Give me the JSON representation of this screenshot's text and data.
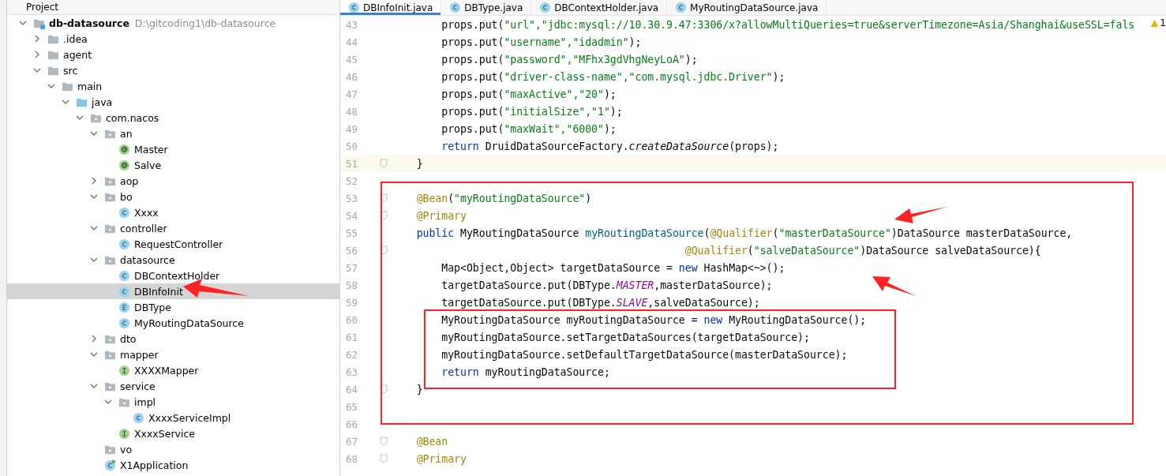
{
  "project_panel": {
    "title": "Project"
  },
  "tree": {
    "name": "db-datasource",
    "path": "D:\\gitcoding1\\db-datasource",
    "kind": "module",
    "expanded": true,
    "selected": false,
    "children": [
      {
        "name": ".idea",
        "kind": "folder",
        "expanded": false,
        "selected": false
      },
      {
        "name": "agent",
        "kind": "folder",
        "expanded": false,
        "selected": false
      },
      {
        "name": "src",
        "kind": "folder",
        "expanded": true,
        "selected": false,
        "children": [
          {
            "name": "main",
            "kind": "folder",
            "expanded": true,
            "selected": false,
            "children": [
              {
                "name": "java",
                "kind": "source",
                "expanded": true,
                "selected": false,
                "children": [
                  {
                    "name": "com.nacos",
                    "kind": "package",
                    "expanded": true,
                    "selected": false,
                    "children": [
                      {
                        "name": "an",
                        "kind": "package",
                        "expanded": true,
                        "selected": false,
                        "children": [
                          {
                            "name": "Master",
                            "kind": "annotation",
                            "selected": false
                          },
                          {
                            "name": "Salve",
                            "kind": "annotation",
                            "selected": false
                          }
                        ]
                      },
                      {
                        "name": "aop",
                        "kind": "package",
                        "expanded": false,
                        "selected": false
                      },
                      {
                        "name": "bo",
                        "kind": "package",
                        "expanded": true,
                        "selected": false,
                        "children": [
                          {
                            "name": "Xxxx",
                            "kind": "class",
                            "selected": false
                          }
                        ]
                      },
                      {
                        "name": "controller",
                        "kind": "package",
                        "expanded": true,
                        "selected": false,
                        "children": [
                          {
                            "name": "RequestController",
                            "kind": "class",
                            "selected": false
                          }
                        ]
                      },
                      {
                        "name": "datasource",
                        "kind": "package",
                        "expanded": true,
                        "selected": false,
                        "children": [
                          {
                            "name": "DBContextHolder",
                            "kind": "class",
                            "selected": false
                          },
                          {
                            "name": "DBInfoInit",
                            "kind": "class",
                            "selected": true
                          },
                          {
                            "name": "DBType",
                            "kind": "enum",
                            "selected": false
                          },
                          {
                            "name": "MyRoutingDataSource",
                            "kind": "class",
                            "selected": false
                          }
                        ]
                      },
                      {
                        "name": "dto",
                        "kind": "package",
                        "expanded": false,
                        "selected": false
                      },
                      {
                        "name": "mapper",
                        "kind": "package",
                        "expanded": true,
                        "selected": false,
                        "children": [
                          {
                            "name": "XXXXMapper",
                            "kind": "interface",
                            "selected": false
                          }
                        ]
                      },
                      {
                        "name": "service",
                        "kind": "package",
                        "expanded": true,
                        "selected": false,
                        "children": [
                          {
                            "name": "impl",
                            "kind": "package",
                            "expanded": true,
                            "selected": false,
                            "children": [
                              {
                                "name": "XxxxServiceImpl",
                                "kind": "class",
                                "selected": false
                              }
                            ]
                          },
                          {
                            "name": "XxxxService",
                            "kind": "interface",
                            "selected": false
                          }
                        ]
                      },
                      {
                        "name": "vo",
                        "kind": "package",
                        "selected": false
                      },
                      {
                        "name": "X1Application",
                        "kind": "app",
                        "selected": false
                      }
                    ]
                  }
                ]
              }
            ]
          }
        ]
      }
    ]
  },
  "tabs": [
    {
      "label": "DBInfoInit.java",
      "selected": true
    },
    {
      "label": "DBType.java",
      "selected": false
    },
    {
      "label": "DBContextHolder.java",
      "selected": false
    },
    {
      "label": "MyRoutingDataSource.java",
      "selected": false
    }
  ],
  "editor": {
    "warning_count": "1",
    "lines": [
      {
        "number": "43",
        "segments": [
          {
            "kind": "plain",
            "text": "        props.put("
          },
          {
            "kind": "string",
            "text": "\"url\",\"jdbc:mysql://10.30.9.47:3306/x?allowMultiQueries=true&serverTimezone=Asia/Shanghai&useSSL=fals"
          }
        ]
      },
      {
        "number": "44",
        "segments": [
          {
            "kind": "plain",
            "text": "        props.put("
          },
          {
            "kind": "string",
            "text": "\"username\",\"idadmin\""
          },
          {
            "kind": "plain",
            "text": ");"
          }
        ]
      },
      {
        "number": "45",
        "segments": [
          {
            "kind": "plain",
            "text": "        props.put("
          },
          {
            "kind": "string",
            "text": "\"password\",\"MFhx3gdVhgNeyLoA\""
          },
          {
            "kind": "plain",
            "text": ");"
          }
        ]
      },
      {
        "number": "46",
        "segments": [
          {
            "kind": "plain",
            "text": "        props.put("
          },
          {
            "kind": "string",
            "text": "\"driver-class-name\",\"com.mysql.jdbc.Driver\""
          },
          {
            "kind": "plain",
            "text": ");"
          }
        ]
      },
      {
        "number": "47",
        "segments": [
          {
            "kind": "plain",
            "text": "        props.put("
          },
          {
            "kind": "string",
            "text": "\"maxActive\",\"20\""
          },
          {
            "kind": "plain",
            "text": ");"
          }
        ]
      },
      {
        "number": "48",
        "segments": [
          {
            "kind": "plain",
            "text": "        props.put("
          },
          {
            "kind": "string",
            "text": "\"initialSize\",\"1\""
          },
          {
            "kind": "plain",
            "text": ");"
          }
        ]
      },
      {
        "number": "49",
        "segments": [
          {
            "kind": "plain",
            "text": "        props.put("
          },
          {
            "kind": "string",
            "text": "\"maxWait\",\"6000\""
          },
          {
            "kind": "plain",
            "text": ");"
          }
        ]
      },
      {
        "number": "50",
        "segments": [
          {
            "kind": "keyword",
            "text": "        return"
          },
          {
            "kind": "plain",
            "text": " DruidDataSourceFactory."
          },
          {
            "kind": "static",
            "text": "createDataSource"
          },
          {
            "kind": "plain",
            "text": "(props);"
          }
        ]
      },
      {
        "number": "51",
        "current": true,
        "fold": true,
        "segments": [
          {
            "kind": "plain",
            "text": "    }"
          }
        ]
      },
      {
        "number": "52",
        "current": false,
        "fold": false
      },
      {
        "number": "53",
        "fold": true,
        "segments": [
          {
            "kind": "annotation",
            "text": "    @Bean"
          },
          {
            "kind": "plain",
            "text": "("
          },
          {
            "kind": "string",
            "text": "\"myRoutingDataSource\""
          },
          {
            "kind": "plain",
            "text": ")"
          }
        ]
      },
      {
        "number": "54",
        "fold": true,
        "segments": [
          {
            "kind": "annotation",
            "text": "    @Primary"
          }
        ]
      },
      {
        "number": "55",
        "fold": false,
        "segments": [
          {
            "kind": "keyword",
            "text": "    public"
          },
          {
            "kind": "plain",
            "text": " MyRoutingDataSource "
          },
          {
            "kind": "declaration",
            "text": "myRoutingDataSource"
          },
          {
            "kind": "plain",
            "text": "("
          },
          {
            "kind": "annotation",
            "text": "@Qualifier"
          },
          {
            "kind": "plain",
            "text": "("
          },
          {
            "kind": "string",
            "text": "\"masterDataSource\""
          },
          {
            "kind": "plain",
            "text": ")DataSource masterDataSource,"
          }
        ]
      },
      {
        "number": "56",
        "fold": true,
        "segments": [
          {
            "kind": "annotation",
            "text": "                                               @Qualifier"
          },
          {
            "kind": "plain",
            "text": "("
          },
          {
            "kind": "string",
            "text": "\"salveDataSource\""
          },
          {
            "kind": "plain",
            "text": ")DataSource salveDataSource){"
          }
        ]
      },
      {
        "number": "57",
        "segments": [
          {
            "kind": "plain",
            "text": "        Map<Object,Object> targetDataSource = "
          },
          {
            "kind": "keyword",
            "text": "new"
          },
          {
            "kind": "plain",
            "text": " HashMap<~>();"
          }
        ]
      },
      {
        "number": "58",
        "segments": [
          {
            "kind": "plain",
            "text": "        targetDataSource.put(DBType."
          },
          {
            "kind": "constant",
            "text": "MASTER"
          },
          {
            "kind": "plain",
            "text": ",masterDataSource);"
          }
        ]
      },
      {
        "number": "59",
        "segments": [
          {
            "kind": "plain",
            "text": "        targetDataSource.put(DBType."
          },
          {
            "kind": "constant",
            "text": "SLAVE"
          },
          {
            "kind": "plain",
            "text": ",salveDataSource);"
          }
        ]
      },
      {
        "number": "60",
        "segments": [
          {
            "kind": "plain",
            "text": "        MyRoutingDataSource myRoutingDataSource = "
          },
          {
            "kind": "keyword",
            "text": "new"
          },
          {
            "kind": "plain",
            "text": " MyRoutingDataSource();"
          }
        ]
      },
      {
        "number": "61",
        "segments": [
          {
            "kind": "plain",
            "text": "        myRoutingDataSource.setTargetDataSources(targetDataSource);"
          }
        ]
      },
      {
        "number": "62",
        "segments": [
          {
            "kind": "plain",
            "text": "        myRoutingDataSource.setDefaultTargetDataSource(masterDataSource);"
          }
        ]
      },
      {
        "number": "63",
        "segments": [
          {
            "kind": "keyword",
            "text": "        return"
          },
          {
            "kind": "plain",
            "text": " myRoutingDataSource;"
          }
        ]
      },
      {
        "number": "64",
        "fold": true,
        "segments": [
          {
            "kind": "plain",
            "text": "    }"
          }
        ]
      },
      {
        "number": "65"
      },
      {
        "number": "66"
      },
      {
        "number": "67",
        "fold": true,
        "segments": [
          {
            "kind": "annotation",
            "text": "    @Bean"
          }
        ]
      },
      {
        "number": "68",
        "fold": true,
        "segments": [
          {
            "kind": "annotation",
            "text": "    @Primary"
          }
        ]
      }
    ]
  }
}
